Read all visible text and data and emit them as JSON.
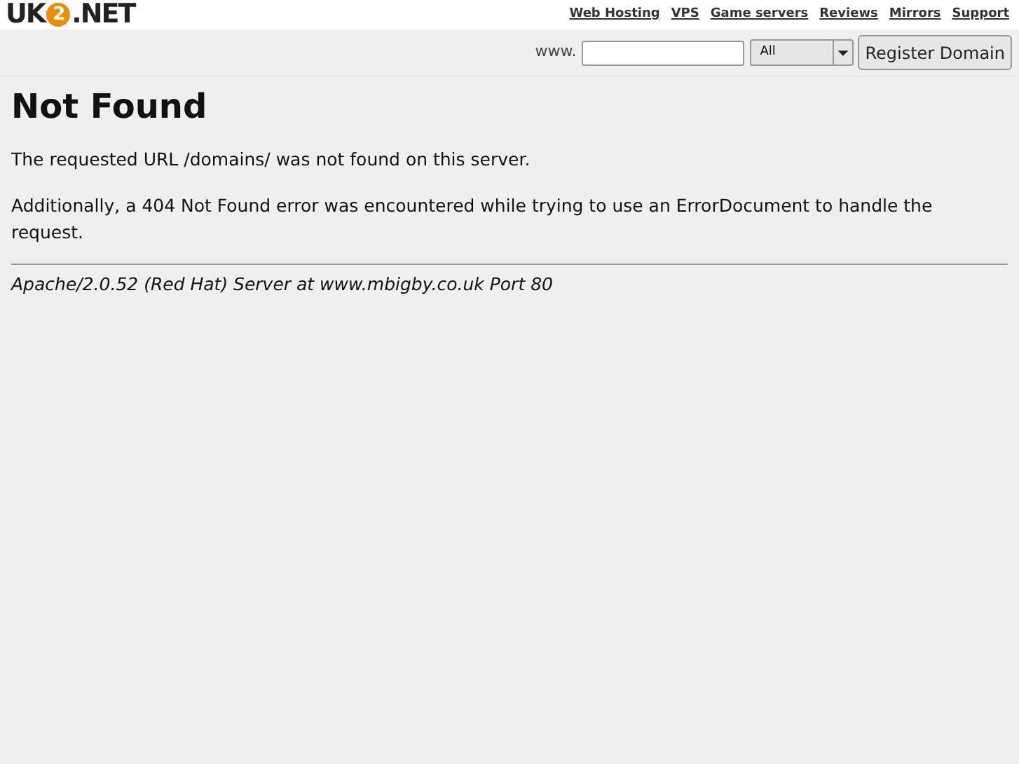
{
  "logo": {
    "prefix": "UK",
    "badge": "2",
    "suffix": ".NET"
  },
  "nav_links": [
    "Web Hosting",
    "VPS",
    "Game servers",
    "Reviews",
    "Mirrors",
    "Support"
  ],
  "domain_search": {
    "prefix_label": "www.",
    "tld": "All",
    "button": "Register Domain"
  },
  "heading": "Not Found",
  "paragraphs": [
    "The requested URL /domains/ was not found on this server.",
    "Additionally, a 404 Not Found error was encountered while trying to use an ErrorDocument to handle the request."
  ],
  "address": "Apache/2.0.52 (Red Hat) Server at www.mbigby.co.uk Port 80"
}
